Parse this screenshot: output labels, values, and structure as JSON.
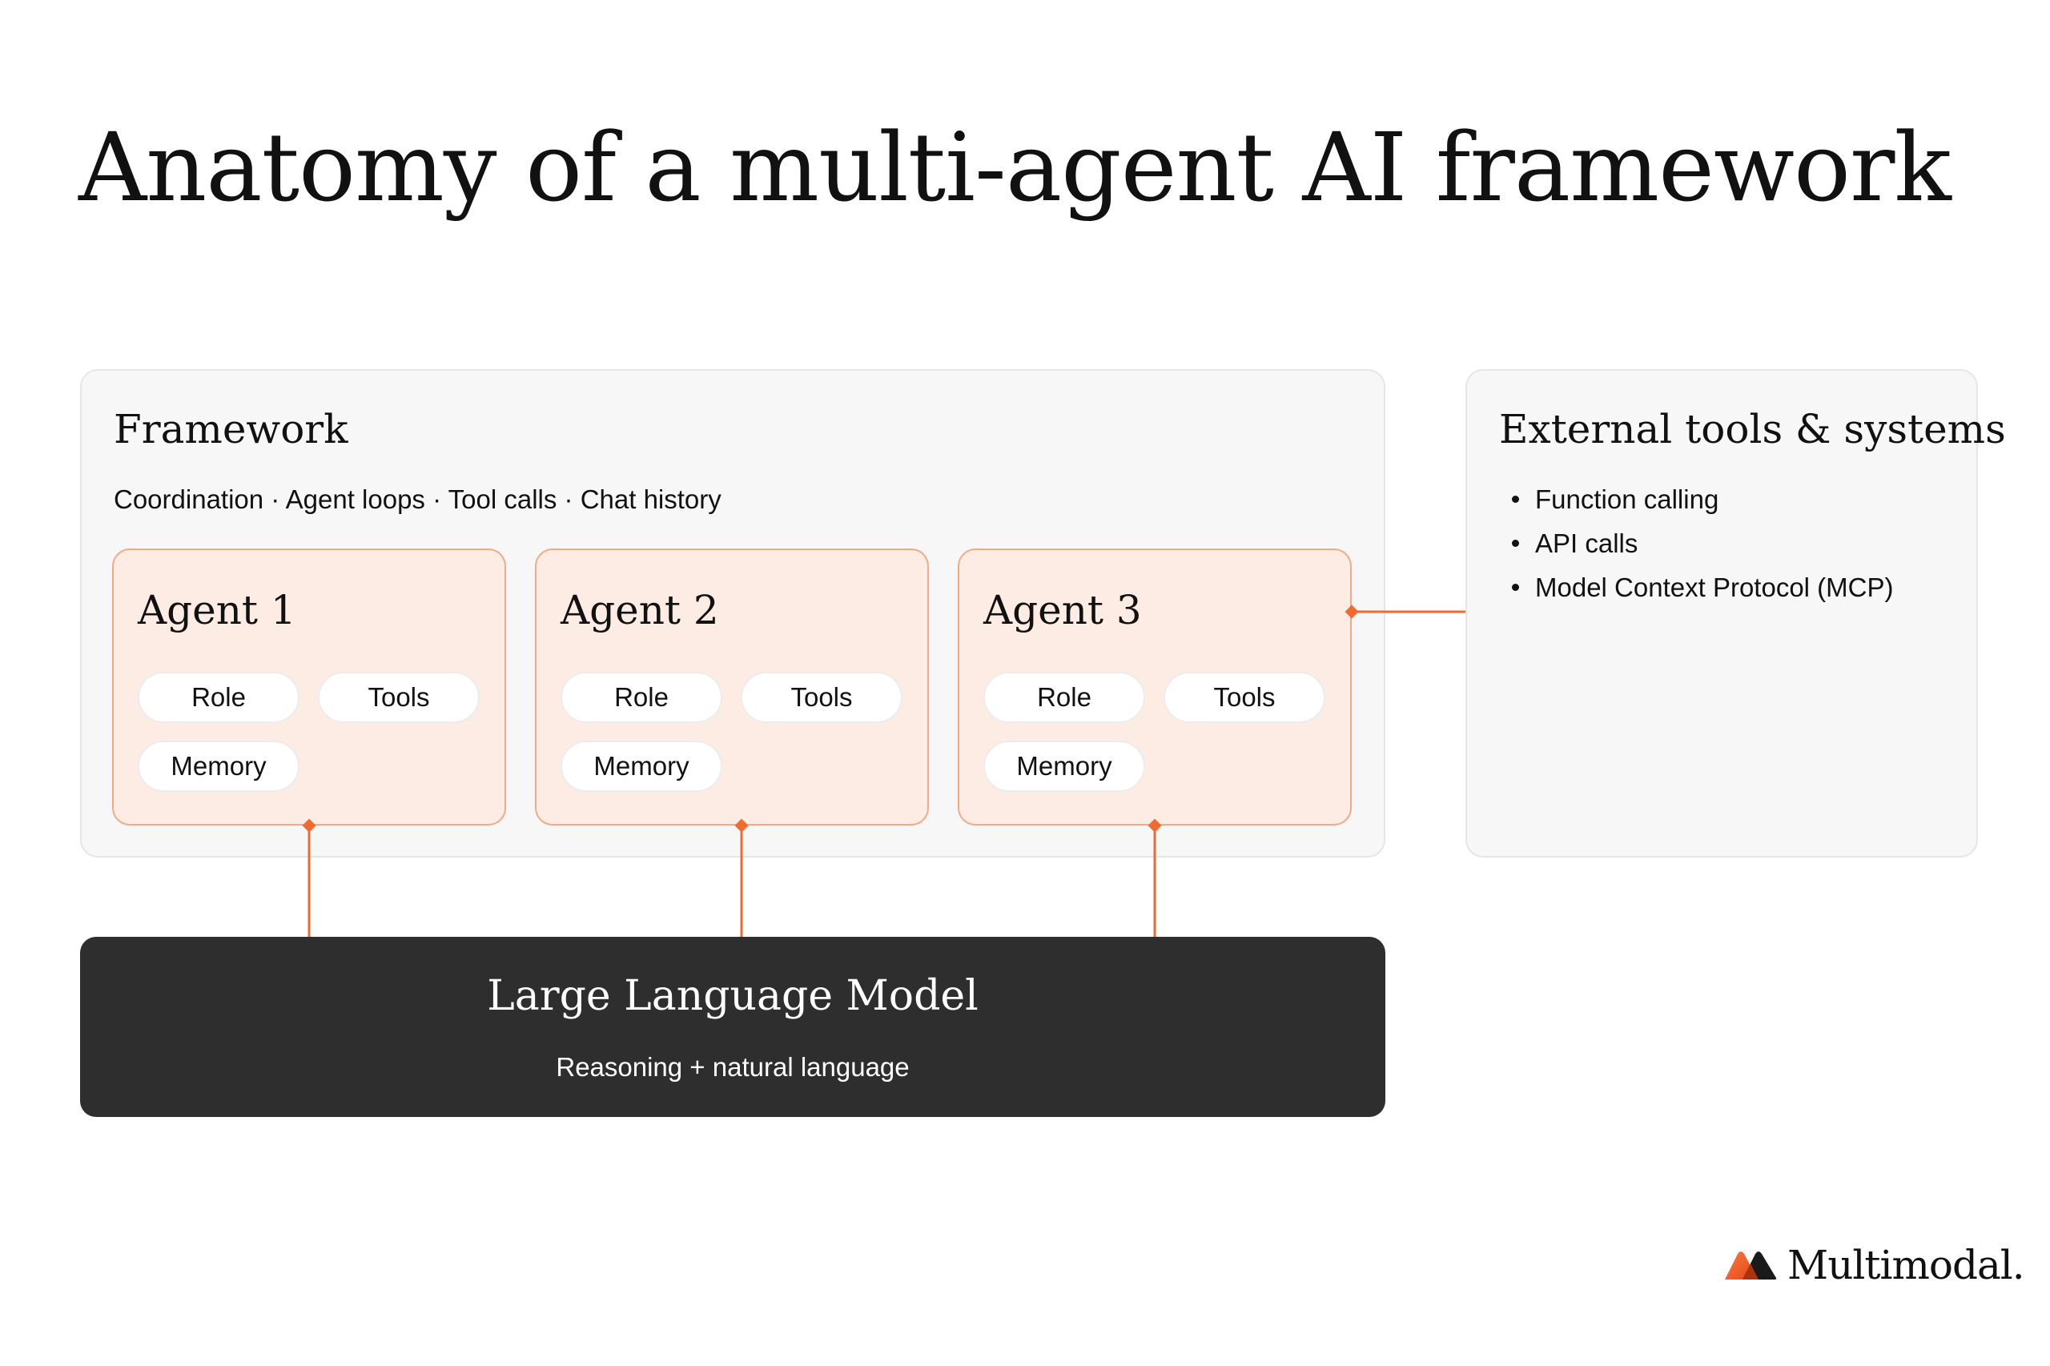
{
  "title": "Anatomy of a multi-agent AI framework",
  "framework": {
    "title": "Framework",
    "subtitle": "Coordination · Agent loops · Tool calls · Chat history",
    "agents": [
      {
        "title": "Agent 1",
        "role": "Role",
        "tools": "Tools",
        "memory": "Memory"
      },
      {
        "title": "Agent 2",
        "role": "Role",
        "tools": "Tools",
        "memory": "Memory"
      },
      {
        "title": "Agent 3",
        "role": "Role",
        "tools": "Tools",
        "memory": "Memory"
      }
    ]
  },
  "external": {
    "title": "External tools & systems",
    "items": [
      "Function calling",
      "API calls",
      "Model Context Protocol (MCP)"
    ]
  },
  "llm": {
    "title": "Large Language Model",
    "subtitle": "Reasoning + natural language"
  },
  "brand": {
    "name": "Multimodal."
  },
  "colors": {
    "accent": "#f26a2e",
    "agent_fill": "#fdece3",
    "agent_border": "#f4a985",
    "panel_fill": "#f7f7f7",
    "llm_fill": "#2e2e2e"
  }
}
